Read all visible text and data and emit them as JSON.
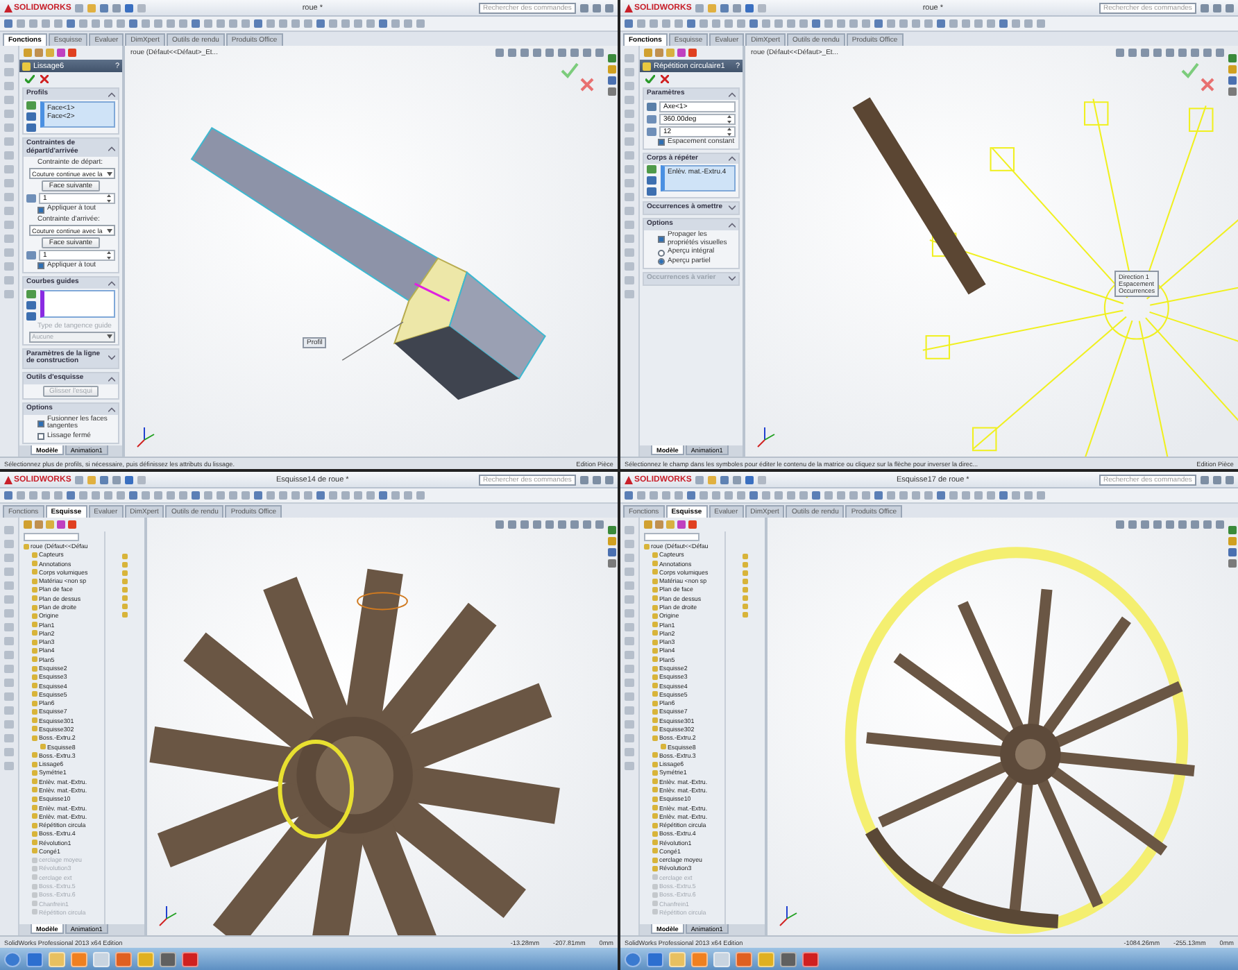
{
  "panes": [
    {
      "app": "SOLIDWORKS",
      "title": "roue *",
      "search": {
        "placeholder": "Rechercher des commandes"
      },
      "tabs": [
        {
          "label": "Fonctions",
          "selected": true
        },
        {
          "label": "Esquisse",
          "selected": false
        },
        {
          "label": "Evaluer",
          "selected": false
        },
        {
          "label": "DimXpert",
          "selected": false
        },
        {
          "label": "Outils de rendu",
          "selected": false
        },
        {
          "label": "Produits Office",
          "selected": false
        }
      ],
      "panel": {
        "kind": "property",
        "title": "Lissage6",
        "help": "?",
        "sections": [
          {
            "title": "Profils",
            "expanded": true,
            "disabled": false,
            "rows": [
              {
                "kind": "list",
                "items": [
                  "Face<1>",
                  "Face<2>"
                ]
              }
            ]
          },
          {
            "title": "Contraintes de départ/d'arrivée",
            "expanded": true,
            "disabled": false,
            "rows": [
              {
                "kind": "label",
                "text": "Contrainte de départ:",
                "disabled": false
              },
              {
                "kind": "select",
                "value": "Couture continue avec la",
                "disabled": false
              },
              {
                "kind": "button",
                "label": "Face suivante",
                "disabled": false
              },
              {
                "kind": "number",
                "value": "1"
              },
              {
                "kind": "checkbox",
                "label": "Appliquer à tout",
                "checked": true
              },
              {
                "kind": "label",
                "text": "Contrainte d'arrivée:",
                "disabled": false
              },
              {
                "kind": "select",
                "value": "Couture continue avec la",
                "disabled": false
              },
              {
                "kind": "button",
                "label": "Face suivante",
                "disabled": false
              },
              {
                "kind": "number",
                "value": "1"
              },
              {
                "kind": "checkbox",
                "label": "Appliquer à tout",
                "checked": true
              }
            ]
          },
          {
            "title": "Courbes guides",
            "expanded": true,
            "disabled": false,
            "rows": [
              {
                "kind": "emptylist"
              },
              {
                "kind": "label",
                "text": "Type de tangence guide",
                "disabled": true
              },
              {
                "kind": "select",
                "value": "Aucune",
                "disabled": true
              }
            ]
          },
          {
            "title": "Paramètres de la ligne de construction",
            "expanded": false,
            "disabled": false
          },
          {
            "title": "Outils d'esquisse",
            "expanded": true,
            "disabled": false,
            "rows": [
              {
                "kind": "button",
                "label": "Glisser l'esqui",
                "disabled": true
              }
            ]
          },
          {
            "title": "Options",
            "expanded": true,
            "disabled": false,
            "rows": [
              {
                "kind": "checkbox",
                "label": "Fusionner les faces tangentes",
                "checked": true
              },
              {
                "kind": "checkbox",
                "label": "Lissage fermé",
                "checked": false
              }
            ]
          }
        ]
      },
      "breadcrumb": "roue (Défaut<<Défaut>_Et...",
      "viewport": {
        "kind": "loft",
        "callouts": [
          "Profil"
        ]
      },
      "bottom_tabs": [
        {
          "label": "Modèle",
          "selected": true
        },
        {
          "label": "Animation1",
          "selected": false
        }
      ],
      "status": [
        "Sélectionnez plus de profils, si nécessaire, puis définissez les attributs du lissage.",
        "Edition Pièce"
      ],
      "taskbar": false
    },
    {
      "app": "SOLIDWORKS",
      "title": "roue *",
      "search": {
        "placeholder": "Rechercher des commandes"
      },
      "tabs": [
        {
          "label": "Fonctions",
          "selected": true
        },
        {
          "label": "Esquisse",
          "selected": false
        },
        {
          "label": "Evaluer",
          "selected": false
        },
        {
          "label": "DimXpert",
          "selected": false
        },
        {
          "label": "Outils de rendu",
          "selected": false
        },
        {
          "label": "Produits Office",
          "selected": false
        }
      ],
      "panel": {
        "kind": "property",
        "title": "Répétition circulaire1",
        "help": "?",
        "sections": [
          {
            "title": "Paramètres",
            "expanded": true,
            "disabled": false,
            "rows": [
              {
                "kind": "field",
                "value": "Axe<1>"
              },
              {
                "kind": "number",
                "value": "360.00deg"
              },
              {
                "kind": "number",
                "value": "12"
              },
              {
                "kind": "checkbox",
                "label": "Espacement constant",
                "checked": true
              }
            ]
          },
          {
            "title": "Corps à répéter",
            "expanded": true,
            "disabled": false,
            "rows": [
              {
                "kind": "list",
                "items": [
                  "Enlèv. mat.-Extru.4"
                ]
              }
            ]
          },
          {
            "title": "Occurrences à omettre",
            "expanded": false,
            "disabled": false
          },
          {
            "title": "Options",
            "expanded": true,
            "disabled": false,
            "rows": [
              {
                "kind": "checkbox",
                "label": "Propager les propriétés visuelles",
                "checked": true
              },
              {
                "kind": "radio",
                "label": "Aperçu intégral",
                "selected": false
              },
              {
                "kind": "radio",
                "label": "Aperçu partiel",
                "selected": true
              }
            ]
          },
          {
            "title": "Occurrences à varier",
            "expanded": false,
            "disabled": true
          }
        ]
      },
      "breadcrumb": "roue (Défaut<<Défaut>_Et...",
      "viewport": {
        "kind": "pattern",
        "callouts": [
          "Direction 1",
          "Espacement",
          "Occurrences"
        ]
      },
      "bottom_tabs": [
        {
          "label": "Modèle",
          "selected": true
        },
        {
          "label": "Animation1",
          "selected": false
        }
      ],
      "status": [
        "Sélectionnez le champ dans les symboles pour éditer le contenu de la matrice ou cliquez sur la flèche pour inverser la direc...",
        "Edition Pièce"
      ],
      "taskbar": false
    },
    {
      "app": "SOLIDWORKS",
      "title": "Esquisse14 de roue *",
      "search": {
        "placeholder": "Rechercher des commandes"
      },
      "tabs": [
        {
          "label": "Fonctions",
          "selected": false
        },
        {
          "label": "Esquisse",
          "selected": true
        },
        {
          "label": "Evaluer",
          "selected": false
        },
        {
          "label": "DimXpert",
          "selected": false
        },
        {
          "label": "Outils de rendu",
          "selected": false
        },
        {
          "label": "Produits Office",
          "selected": false
        }
      ],
      "panel": {
        "kind": "tree",
        "root": "roue (Défaut<<Défau",
        "items": [
          {
            "label": "Capteurs",
            "suppressed": false
          },
          {
            "label": "Annotations",
            "suppressed": false
          },
          {
            "label": "Corps volumiques",
            "suppressed": false
          },
          {
            "label": "Matériau <non sp",
            "suppressed": false
          },
          {
            "label": "Plan de face",
            "suppressed": false
          },
          {
            "label": "Plan de dessus",
            "suppressed": false
          },
          {
            "label": "Plan de droite",
            "suppressed": false
          },
          {
            "label": "Origine",
            "suppressed": false
          },
          {
            "label": "Plan1",
            "suppressed": false
          },
          {
            "label": "Plan2",
            "suppressed": false
          },
          {
            "label": "Plan3",
            "suppressed": false
          },
          {
            "label": "Plan4",
            "suppressed": false
          },
          {
            "label": "Plan5",
            "suppressed": false
          },
          {
            "label": "Esquisse2",
            "suppressed": false
          },
          {
            "label": "Esquisse3",
            "suppressed": false
          },
          {
            "label": "Esquisse4",
            "suppressed": false
          },
          {
            "label": "Esquisse5",
            "suppressed": false
          },
          {
            "label": "Plan6",
            "suppressed": false
          },
          {
            "label": "Esquisse7",
            "suppressed": false
          },
          {
            "label": "Esquisse301",
            "suppressed": false
          },
          {
            "label": "Esquisse302",
            "suppressed": false
          },
          {
            "label": "Boss.-Extru.2",
            "suppressed": false,
            "children": [
              {
                "label": "Esquisse8",
                "suppressed": false
              }
            ]
          },
          {
            "label": "Boss.-Extru.3",
            "suppressed": false
          },
          {
            "label": "Lissage6",
            "suppressed": false
          },
          {
            "label": "Symétrie1",
            "suppressed": false
          },
          {
            "label": "Enlèv. mat.-Extru.",
            "suppressed": false
          },
          {
            "label": "Enlèv. mat.-Extru.",
            "suppressed": false
          },
          {
            "label": "Esquisse10",
            "suppressed": false
          },
          {
            "label": "Enlèv. mat.-Extru.",
            "suppressed": false
          },
          {
            "label": "Enlèv. mat.-Extru.",
            "suppressed": false
          },
          {
            "label": "Répétition circula",
            "suppressed": false
          },
          {
            "label": "Boss.-Extru.4",
            "suppressed": false
          },
          {
            "label": "Révolution1",
            "suppressed": false
          },
          {
            "label": "Congé1",
            "suppressed": false
          },
          {
            "label": "cerclage moyeu",
            "suppressed": true
          },
          {
            "label": "Révolution3",
            "suppressed": true
          },
          {
            "label": "cerclage ext",
            "suppressed": true
          },
          {
            "label": "Boss.-Extru.5",
            "suppressed": true
          },
          {
            "label": "Boss.-Extru.6",
            "suppressed": true
          },
          {
            "label": "Chanfrein1",
            "suppressed": true
          },
          {
            "label": "Répétition circula",
            "suppressed": true
          }
        ]
      },
      "viewport": {
        "kind": "closeup"
      },
      "bottom_tabs": [
        {
          "label": "Modèle",
          "selected": true
        },
        {
          "label": "Animation1",
          "selected": false
        }
      ],
      "status": [
        "SolidWorks Professional 2013 x64 Edition",
        "-13.28mm",
        "-207.81mm",
        "0mm"
      ],
      "taskbar": true
    },
    {
      "app": "SOLIDWORKS",
      "title": "Esquisse17 de roue *",
      "search": {
        "placeholder": "Rechercher des commandes"
      },
      "tabs": [
        {
          "label": "Fonctions",
          "selected": false
        },
        {
          "label": "Esquisse",
          "selected": true
        },
        {
          "label": "Evaluer",
          "selected": false
        },
        {
          "label": "DimXpert",
          "selected": false
        },
        {
          "label": "Outils de rendu",
          "selected": false
        },
        {
          "label": "Produits Office",
          "selected": false
        }
      ],
      "panel": {
        "kind": "tree",
        "root": "roue (Défaut<<Défau",
        "items": [
          {
            "label": "Capteurs",
            "suppressed": false
          },
          {
            "label": "Annotations",
            "suppressed": false
          },
          {
            "label": "Corps volumiques",
            "suppressed": false
          },
          {
            "label": "Matériau <non sp",
            "suppressed": false
          },
          {
            "label": "Plan de face",
            "suppressed": false
          },
          {
            "label": "Plan de dessus",
            "suppressed": false
          },
          {
            "label": "Plan de droite",
            "suppressed": false
          },
          {
            "label": "Origine",
            "suppressed": false
          },
          {
            "label": "Plan1",
            "suppressed": false
          },
          {
            "label": "Plan2",
            "suppressed": false
          },
          {
            "label": "Plan3",
            "suppressed": false
          },
          {
            "label": "Plan4",
            "suppressed": false
          },
          {
            "label": "Plan5",
            "suppressed": false
          },
          {
            "label": "Esquisse2",
            "suppressed": false
          },
          {
            "label": "Esquisse3",
            "suppressed": false
          },
          {
            "label": "Esquisse4",
            "suppressed": false
          },
          {
            "label": "Esquisse5",
            "suppressed": false
          },
          {
            "label": "Plan6",
            "suppressed": false
          },
          {
            "label": "Esquisse7",
            "suppressed": false
          },
          {
            "label": "Esquisse301",
            "suppressed": false
          },
          {
            "label": "Esquisse302",
            "suppressed": false
          },
          {
            "label": "Boss.-Extru.2",
            "suppressed": false,
            "children": [
              {
                "label": "Esquisse8",
                "suppressed": false
              }
            ]
          },
          {
            "label": "Boss.-Extru.3",
            "suppressed": false
          },
          {
            "label": "Lissage6",
            "suppressed": false
          },
          {
            "label": "Symétrie1",
            "suppressed": false
          },
          {
            "label": "Enlèv. mat.-Extru.",
            "suppressed": false
          },
          {
            "label": "Enlèv. mat.-Extru.",
            "suppressed": false
          },
          {
            "label": "Esquisse10",
            "suppressed": false
          },
          {
            "label": "Enlèv. mat.-Extru.",
            "suppressed": false
          },
          {
            "label": "Enlèv. mat.-Extru.",
            "suppressed": false
          },
          {
            "label": "Répétition circula",
            "suppressed": false
          },
          {
            "label": "Boss.-Extru.4",
            "suppressed": false
          },
          {
            "label": "Révolution1",
            "suppressed": false
          },
          {
            "label": "Congé1",
            "suppressed": false
          },
          {
            "label": "cerclage moyeu",
            "suppressed": false
          },
          {
            "label": "Révolution3",
            "suppressed": false
          },
          {
            "label": "cerclage ext",
            "suppressed": true
          },
          {
            "label": "Boss.-Extru.5",
            "suppressed": true
          },
          {
            "label": "Boss.-Extru.6",
            "suppressed": true
          },
          {
            "label": "Chanfrein1",
            "suppressed": true
          },
          {
            "label": "Répétition circula",
            "suppressed": true
          }
        ]
      },
      "viewport": {
        "kind": "wheel"
      },
      "bottom_tabs": [
        {
          "label": "Modèle",
          "selected": true
        },
        {
          "label": "Animation1",
          "selected": false
        }
      ],
      "status": [
        "SolidWorks Professional 2013 x64 Edition",
        "-1084.26mm",
        "-255.13mm",
        "0mm"
      ],
      "taskbar": true
    }
  ]
}
